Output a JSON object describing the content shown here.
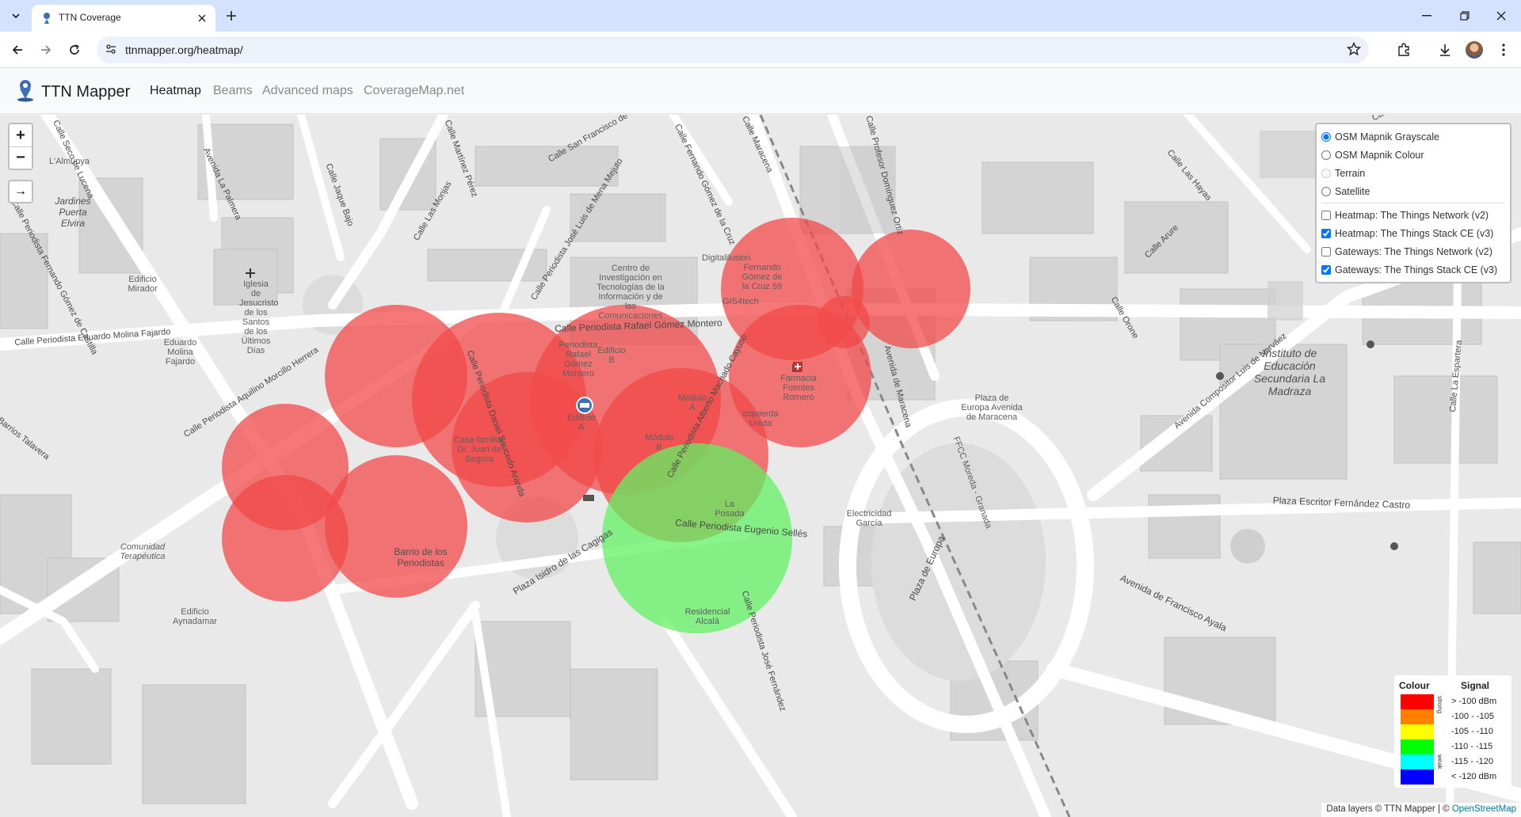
{
  "browser": {
    "tab_title": "TTN Coverage",
    "url": "ttnmapper.org/heatmap/"
  },
  "navbar": {
    "brand": "TTN Mapper",
    "links": [
      {
        "label": "Heatmap",
        "active": true
      },
      {
        "label": "Beams",
        "active": false
      },
      {
        "label": "Advanced maps",
        "active": false
      },
      {
        "label": "CoverageMap.net",
        "active": false
      }
    ]
  },
  "map": {
    "zoom_in": "+",
    "zoom_out": "−",
    "locate": "→",
    "base_layers": [
      {
        "label": "OSM Mapnik Grayscale",
        "selected": true,
        "enabled": true
      },
      {
        "label": "OSM Mapnik Colour",
        "selected": false,
        "enabled": true
      },
      {
        "label": "Terrain",
        "selected": false,
        "enabled": false
      },
      {
        "label": "Satellite",
        "selected": false,
        "enabled": true
      }
    ],
    "overlays": [
      {
        "label": "Heatmap: The Things Network (v2)",
        "checked": false
      },
      {
        "label": "Heatmap: The Things Stack CE (v3)",
        "checked": true
      },
      {
        "label": "Gateways: The Things Network (v2)",
        "checked": false
      },
      {
        "label": "Gateways: The Things Stack CE (v3)",
        "checked": true
      }
    ],
    "legend": {
      "colour_header": "Colour",
      "signal_header": "Signal",
      "strong_label": "strong",
      "weak_label": "weak",
      "entries": [
        {
          "color": "#ff0000",
          "label": "> -100 dBm"
        },
        {
          "color": "#ff7f00",
          "label": "-100 - -105"
        },
        {
          "color": "#ffff00",
          "label": "-105 - -110"
        },
        {
          "color": "#00ff00",
          "label": "-110 - -115"
        },
        {
          "color": "#00ffff",
          "label": "-115 - -120"
        },
        {
          "color": "#0000ff",
          "label": "< -120 dBm"
        }
      ]
    },
    "attribution_text": "Data layers © TTN Mapper | © ",
    "attribution_link": "OpenStreetMap",
    "street_labels": [
      "Calle Periodista Eduardo Molina Fajardo",
      "Calle Periodista Aquilino Morcillo Herrera",
      "Calle Periodista Rafael Gómez Montero",
      "Calle Periodista Daniel Saucedo Aranda",
      "Calle Periodista Alberto Machado Cayuso",
      "Calle Periodista Eugenio Sellés",
      "Calle Periodista José Luis de Mena Mejuto",
      "Calle San Francisco de Sales",
      "Calle Fernando Gómez de la Cruz",
      "Calle Martínez Pérez",
      "Calle Jaque Bajo",
      "Calle Las Monjas",
      "Avenida La Palmera",
      "Calle Periodista Fernando Gómez de Castilla",
      "Avenida de Maracena",
      "Plaza de Europa",
      "Plaza Escritor Fernández Castro",
      "Avenida Compositor Luis de Narváez",
      "Calle Orone",
      "Calle Arure",
      "Calle Las Hayas",
      "Calle La Espartera",
      "Avenida de Francisco Ayala",
      "Plaza Isidro de las Cagigas",
      "Calle Profesor Domínguez Ortiz",
      "Barrios Talavera",
      "Calle Periodista José Fernández",
      "Calle Seco de Lucena",
      "Calle La Pr",
      "Calle Maracena"
    ],
    "place_labels": [
      "Barrio de los Periodistas",
      "Jardines Puerta Elvira",
      "Instituto de Educación Secundaria La Madraza",
      "Centro de Investigación en Tecnologías de la Información y de las Comunicaciones",
      "Iglesia de Jesucristo de los Santos de los Últimos Días",
      "Edificio Mirador",
      "Eduardo Molina Fajardo",
      "Periodista Rafael Gómez Montero",
      "Edificio B",
      "Edificio A",
      "Módulo A",
      "Módulo B",
      "Farmacia Fuentes Romero",
      "Izquierda Unida",
      "Casa familiar Dr. Juan de Segura",
      "Fernando Gómez de la Cruz 59",
      "Digitalilusion",
      "GIS4tech",
      "La Posada",
      "Electricidad García",
      "Residencial Alcalá",
      "Edificio Aynadamar",
      "Comunidad Terapéutica",
      "Plaza de Europa Avenida de Maracena",
      "FFCC Moreda - Granada",
      "L'Almunya"
    ]
  }
}
